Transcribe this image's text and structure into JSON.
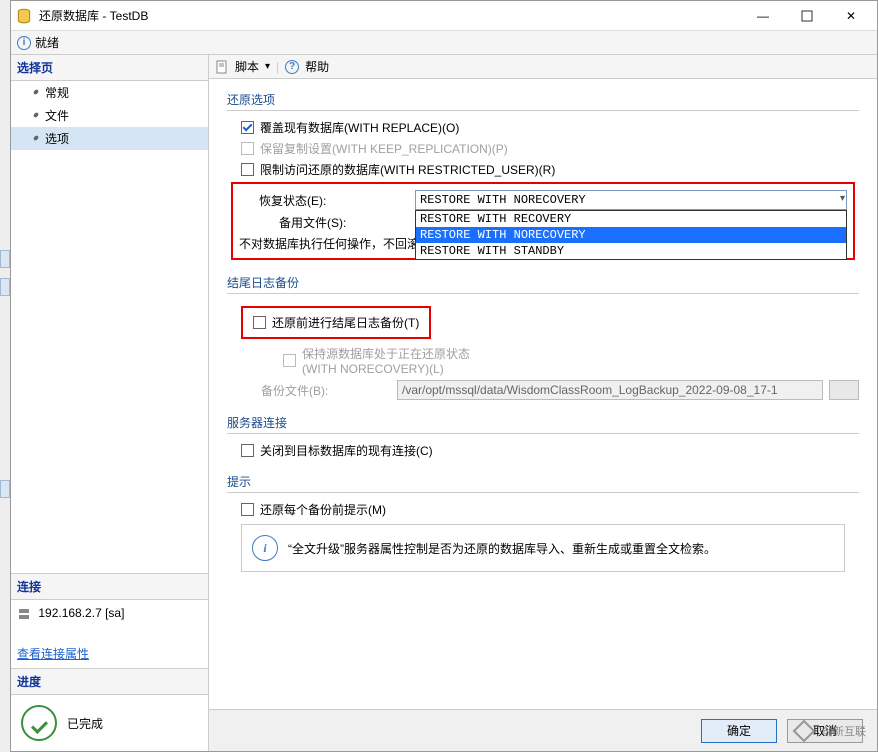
{
  "window": {
    "title": "还原数据库 - TestDB"
  },
  "status": {
    "text": "就绪"
  },
  "sidebar": {
    "select_title": "选择页",
    "items": [
      {
        "label": "常规"
      },
      {
        "label": "文件"
      },
      {
        "label": "选项"
      }
    ],
    "conn_title": "连接",
    "conn_server": "192.168.2.7 [sa]",
    "conn_link": "查看连接属性",
    "progress_title": "进度",
    "progress_done": "已完成"
  },
  "toolbar": {
    "script": "脚本",
    "help": "帮助"
  },
  "restore_options": {
    "title": "还原选项",
    "overwrite": "覆盖现有数据库(WITH REPLACE)(O)",
    "keep_repl": "保留复制设置(WITH KEEP_REPLICATION)(P)",
    "restricted": "限制访问还原的数据库(WITH RESTRICTED_USER)(R)",
    "recovery_state_label": "恢复状态(E):",
    "standby_file_label": "备用文件(S):",
    "no_op_text": "不对数据库执行任何操作，不回滚",
    "dropdown_selected": "RESTORE WITH NORECOVERY",
    "dropdown_options": [
      "RESTORE WITH RECOVERY",
      "RESTORE WITH NORECOVERY",
      "RESTORE WITH STANDBY"
    ]
  },
  "tail_log": {
    "title": "结尾日志备份",
    "before_restore": "还原前进行结尾日志备份(T)",
    "keep_src": "保持源数据库处于正在还原状态",
    "keep_src2": "(WITH NORECOVERY)(L)",
    "backup_file_label": "备份文件(B):",
    "backup_file_value": "/var/opt/mssql/data/WisdomClassRoom_LogBackup_2022-09-08_17-1"
  },
  "server_conn": {
    "title": "服务器连接",
    "close_existing": "关闭到目标数据库的现有连接(C)"
  },
  "hint": {
    "title": "提示",
    "before_each": "还原每个备份前提示(M)",
    "tip_text": "“全文升级”服务器属性控制是否为还原的数据库导入、重新生成或重置全文检索。"
  },
  "footer": {
    "ok": "确定",
    "cancel": "取消"
  },
  "brand": "创新互联"
}
